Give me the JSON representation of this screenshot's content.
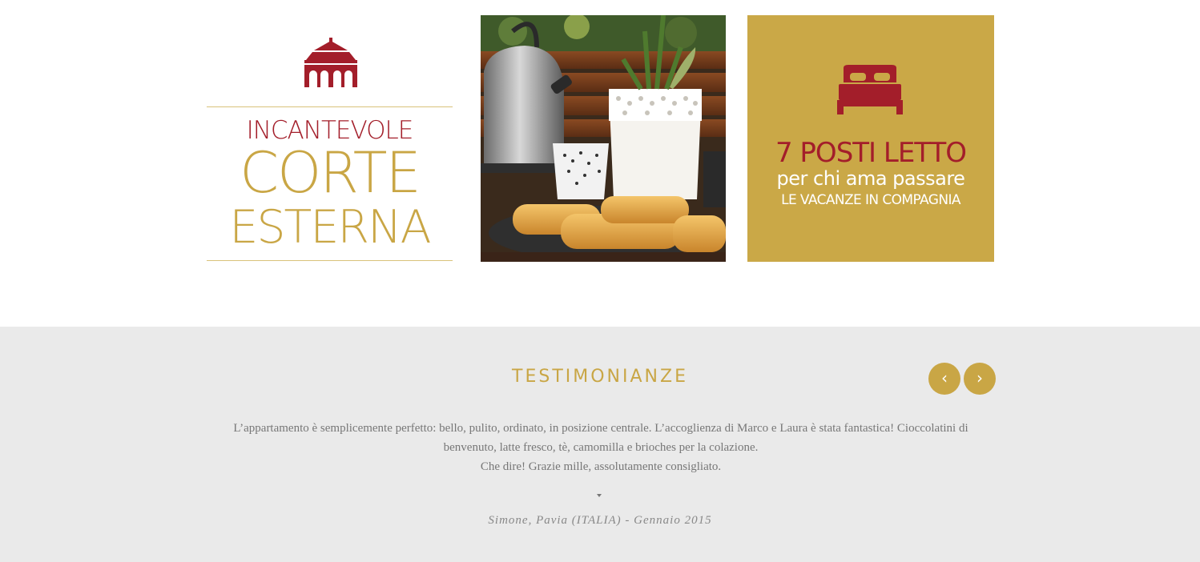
{
  "tiles": {
    "logo": {
      "line1": "INCANTEVOLE",
      "line2": "CORTE",
      "line3": "ESTERNA",
      "icon": "pavilion-icon",
      "colors": {
        "red": "#a31e2a",
        "gold": "#c9a645"
      }
    },
    "photo": {
      "subject": "breakfast-table-photo"
    },
    "beds": {
      "icon": "bed-icon",
      "title": "7 POSTI LETTO",
      "subtitle": "per chi ama passare",
      "caps": "LE VACANZE IN COMPAGNIA",
      "background": "#caa847"
    }
  },
  "testimonials": {
    "heading": "TESTIMONIANZE",
    "prev_label": "‹",
    "next_label": "›",
    "quote": {
      "line1": "L’appartamento è semplicemente perfetto: bello, pulito, ordinato, in posizione centrale. L’accoglienza di Marco e Laura è stata fantastica! Cioccolatini di benvenuto, latte fresco, tè, camomilla e brioches per la colazione.",
      "line2": "Che dire! Grazie mille, assolutamente consigliato."
    },
    "author": "Simone, Pavia (ITALIA) - Gennaio 2015",
    "background": "#eaeaea",
    "accent": "#c9a645"
  }
}
